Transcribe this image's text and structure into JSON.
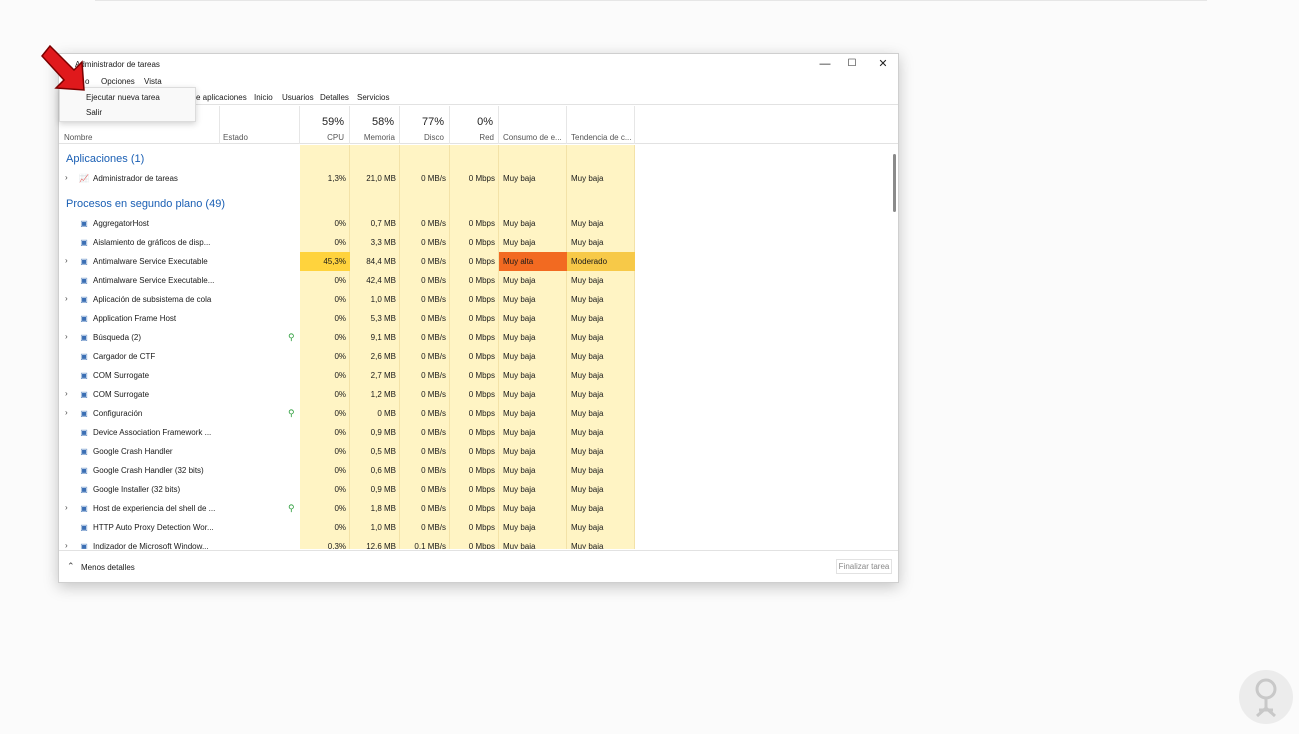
{
  "window": {
    "title": "Administrador de tareas",
    "controls": {
      "minimize": "—",
      "maximize": "☐",
      "close": "✕"
    }
  },
  "menubar": {
    "file": "o",
    "options": "Opciones",
    "view": "Vista"
  },
  "file_menu": {
    "items": [
      "Ejecutar nueva tarea",
      "Salir"
    ]
  },
  "tabs": [
    "e aplicaciones",
    "Inicio",
    "Usuarios",
    "Detalles",
    "Servicios"
  ],
  "columns": {
    "name": "Nombre",
    "status": "Estado",
    "cpu": {
      "percent": "59%",
      "label": "CPU"
    },
    "memory": {
      "percent": "58%",
      "label": "Memoria"
    },
    "disk": {
      "percent": "77%",
      "label": "Disco"
    },
    "network": {
      "percent": "0%",
      "label": "Red"
    },
    "power": "Consumo de e...",
    "power_trend": "Tendencia de c..."
  },
  "groups": {
    "apps": "Aplicaciones (1)",
    "background": "Procesos en segundo plano (49)"
  },
  "app_rows": [
    {
      "name": "Administrador de tareas",
      "icon": "task-manager-icon",
      "expand": true,
      "cpu": "1,3%",
      "mem": "21,0 MB",
      "disk": "0 MB/s",
      "net": "0 Mbps",
      "power": "Muy baja",
      "trend": "Muy baja"
    }
  ],
  "bg_rows": [
    {
      "name": "AggregatorHost",
      "expand": false,
      "leaf": false,
      "cpu": "0%",
      "mem": "0,7 MB",
      "disk": "0 MB/s",
      "net": "0 Mbps",
      "power": "Muy baja",
      "trend": "Muy baja"
    },
    {
      "name": "Aislamiento de gráficos de disp...",
      "expand": false,
      "leaf": false,
      "cpu": "0%",
      "mem": "3,3 MB",
      "disk": "0 MB/s",
      "net": "0 Mbps",
      "power": "Muy baja",
      "trend": "Muy baja"
    },
    {
      "name": "Antimalware Service Executable",
      "expand": true,
      "leaf": false,
      "cpu": "45,3%",
      "mem": "84,4 MB",
      "disk": "0 MB/s",
      "net": "0 Mbps",
      "power": "Muy alta",
      "trend": "Moderado",
      "hot": true
    },
    {
      "name": "Antimalware Service Executable...",
      "expand": false,
      "leaf": false,
      "cpu": "0%",
      "mem": "42,4 MB",
      "disk": "0 MB/s",
      "net": "0 Mbps",
      "power": "Muy baja",
      "trend": "Muy baja"
    },
    {
      "name": "Aplicación de subsistema de cola",
      "expand": true,
      "leaf": false,
      "cpu": "0%",
      "mem": "1,0 MB",
      "disk": "0 MB/s",
      "net": "0 Mbps",
      "power": "Muy baja",
      "trend": "Muy baja"
    },
    {
      "name": "Application Frame Host",
      "expand": false,
      "leaf": false,
      "cpu": "0%",
      "mem": "5,3 MB",
      "disk": "0 MB/s",
      "net": "0 Mbps",
      "power": "Muy baja",
      "trend": "Muy baja"
    },
    {
      "name": "Búsqueda (2)",
      "expand": true,
      "leaf": true,
      "cpu": "0%",
      "mem": "9,1 MB",
      "disk": "0 MB/s",
      "net": "0 Mbps",
      "power": "Muy baja",
      "trend": "Muy baja"
    },
    {
      "name": "Cargador de CTF",
      "expand": false,
      "leaf": false,
      "cpu": "0%",
      "mem": "2,6 MB",
      "disk": "0 MB/s",
      "net": "0 Mbps",
      "power": "Muy baja",
      "trend": "Muy baja"
    },
    {
      "name": "COM Surrogate",
      "expand": false,
      "leaf": false,
      "cpu": "0%",
      "mem": "2,7 MB",
      "disk": "0 MB/s",
      "net": "0 Mbps",
      "power": "Muy baja",
      "trend": "Muy baja"
    },
    {
      "name": "COM Surrogate",
      "expand": true,
      "leaf": false,
      "cpu": "0%",
      "mem": "1,2 MB",
      "disk": "0 MB/s",
      "net": "0 Mbps",
      "power": "Muy baja",
      "trend": "Muy baja"
    },
    {
      "name": "Configuración",
      "expand": true,
      "leaf": true,
      "cpu": "0%",
      "mem": "0 MB",
      "disk": "0 MB/s",
      "net": "0 Mbps",
      "power": "Muy baja",
      "trend": "Muy baja"
    },
    {
      "name": "Device Association Framework ...",
      "expand": false,
      "leaf": false,
      "cpu": "0%",
      "mem": "0,9 MB",
      "disk": "0 MB/s",
      "net": "0 Mbps",
      "power": "Muy baja",
      "trend": "Muy baja"
    },
    {
      "name": "Google Crash Handler",
      "expand": false,
      "leaf": false,
      "cpu": "0%",
      "mem": "0,5 MB",
      "disk": "0 MB/s",
      "net": "0 Mbps",
      "power": "Muy baja",
      "trend": "Muy baja"
    },
    {
      "name": "Google Crash Handler (32 bits)",
      "expand": false,
      "leaf": false,
      "cpu": "0%",
      "mem": "0,6 MB",
      "disk": "0 MB/s",
      "net": "0 Mbps",
      "power": "Muy baja",
      "trend": "Muy baja"
    },
    {
      "name": "Google Installer (32 bits)",
      "expand": false,
      "leaf": false,
      "cpu": "0%",
      "mem": "0,9 MB",
      "disk": "0 MB/s",
      "net": "0 Mbps",
      "power": "Muy baja",
      "trend": "Muy baja"
    },
    {
      "name": "Host de experiencia del shell de ...",
      "expand": true,
      "leaf": true,
      "cpu": "0%",
      "mem": "1,8 MB",
      "disk": "0 MB/s",
      "net": "0 Mbps",
      "power": "Muy baja",
      "trend": "Muy baja"
    },
    {
      "name": "HTTP Auto Proxy Detection Wor...",
      "expand": false,
      "leaf": false,
      "cpu": "0%",
      "mem": "1,0 MB",
      "disk": "0 MB/s",
      "net": "0 Mbps",
      "power": "Muy baja",
      "trend": "Muy baja"
    },
    {
      "name": "Indizador de Microsoft Window...",
      "expand": true,
      "leaf": false,
      "cpu": "0,3%",
      "mem": "12,6 MB",
      "disk": "0,1 MB/s",
      "net": "0 Mbps",
      "power": "Muy baja",
      "trend": "Muy baja"
    }
  ],
  "footer": {
    "less_details": "Menos detalles",
    "end_task": "Finalizar tarea"
  },
  "colors": {
    "heat": "#fff4c4",
    "hot_cpu": "#ffd33d",
    "hot_power": "#f26a21",
    "hot_trend": "#f7c948",
    "group": "#1a5fb4",
    "arrow": "#e0191c"
  }
}
